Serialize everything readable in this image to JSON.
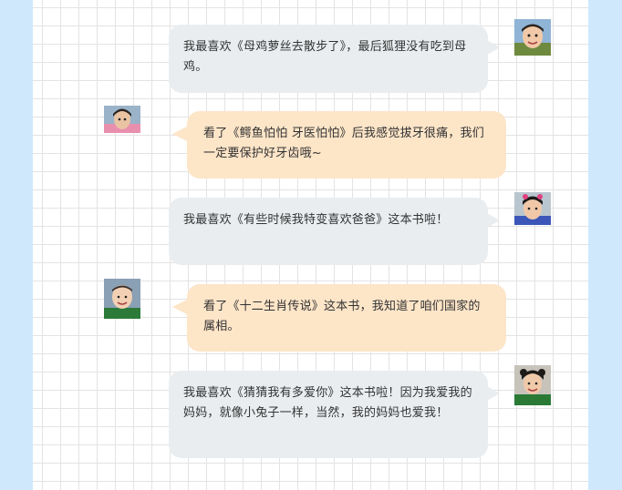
{
  "messages": [
    {
      "side": "right",
      "bubble_color": "#e9edf0",
      "avatar": "child-avatar-1",
      "text": "我最喜欢《母鸡萝丝去散步了》，最后狐狸没有吃到母鸡。"
    },
    {
      "side": "left",
      "bubble_color": "#fde5c8",
      "avatar": "child-avatar-2",
      "text": "看了《鳄鱼怕怕 牙医怕怕》后我感觉拔牙很痛，我们一定要保护好牙齿哦~"
    },
    {
      "side": "right",
      "bubble_color": "#e9edf0",
      "avatar": "child-avatar-3",
      "text": "我最喜欢《有些时候我特变喜欢爸爸》这本书啦！"
    },
    {
      "side": "left",
      "bubble_color": "#fde5c8",
      "avatar": "child-avatar-4",
      "text": "看了《十二生肖传说》这本书，我知道了咱们国家的属相。"
    },
    {
      "side": "right",
      "bubble_color": "#e9edf0",
      "avatar": "child-avatar-5",
      "text": "我最喜欢《猜猜我有多爱你》这本书啦！因为我爱我的妈妈，就像小兔子一样，当然，我的妈妈也爱我！"
    }
  ],
  "colors": {
    "side_bg": "#cfe8fb",
    "grid_line": "#e3e3e3",
    "gray_bubble": "#e9edf0",
    "peach_bubble": "#fde5c8"
  }
}
